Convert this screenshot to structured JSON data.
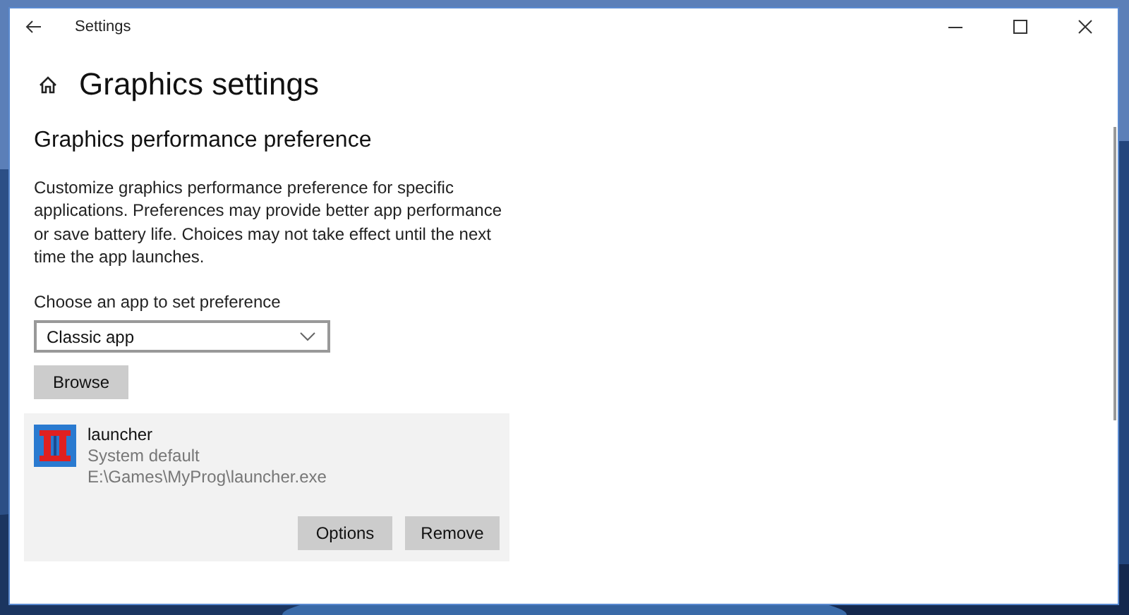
{
  "window": {
    "title": "Settings"
  },
  "page": {
    "title": "Graphics settings"
  },
  "section": {
    "title": "Graphics performance preference",
    "description": "Customize graphics performance preference for specific applications. Preferences may provide better app performance or save battery life. Choices may not take effect until the next time the app launches."
  },
  "app_picker": {
    "label": "Choose an app to set preference",
    "value": "Classic app",
    "button": "Browse"
  },
  "apps": [
    {
      "name": "launcher",
      "preference": "System default",
      "path": "E:\\Games\\MyProg\\launcher.exe",
      "selected": true,
      "buttons": [
        "Options",
        "Remove"
      ]
    }
  ]
}
